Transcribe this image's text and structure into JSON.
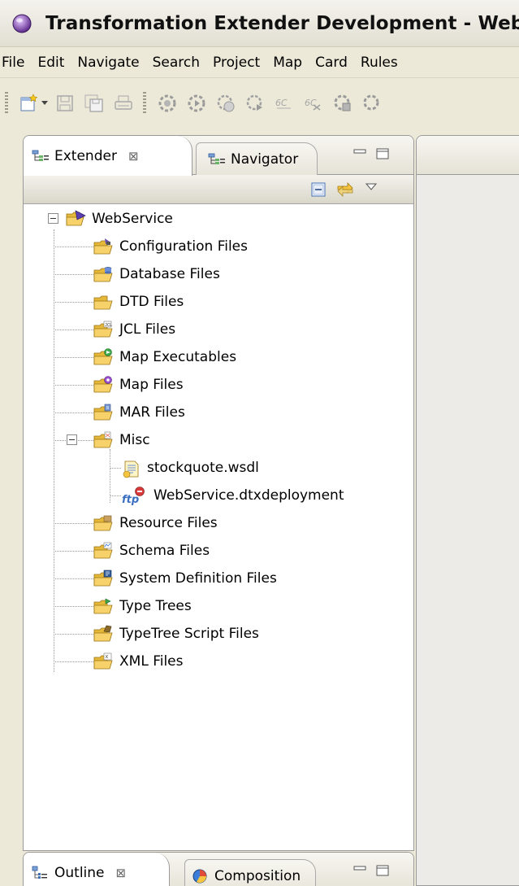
{
  "window": {
    "title": "Transformation Extender Development - Web"
  },
  "menubar": {
    "items": [
      "File",
      "Edit",
      "Navigate",
      "Search",
      "Project",
      "Map",
      "Card",
      "Rules"
    ]
  },
  "toolbar": {
    "icons": [
      "new-wizard-icon",
      "save-icon",
      "save-all-icon",
      "print-icon",
      "build-map-icon",
      "run-map-icon",
      "build-all-icon",
      "run-all-icon",
      "compare-icon",
      "compare-all-icon",
      "deploy-icon",
      "deploy-all-icon"
    ]
  },
  "explorer": {
    "tabs": [
      {
        "label": "Extender",
        "active": true
      },
      {
        "label": "Navigator",
        "active": false
      }
    ],
    "project": "WebService",
    "items": [
      {
        "label": "Configuration Files",
        "icon": "configuration-folder-icon"
      },
      {
        "label": "Database Files",
        "icon": "database-folder-icon"
      },
      {
        "label": "DTD Files",
        "icon": "folder-icon"
      },
      {
        "label": "JCL Files",
        "icon": "jcl-folder-icon"
      },
      {
        "label": "Map Executables",
        "icon": "map-executables-folder-icon"
      },
      {
        "label": "Map Files",
        "icon": "map-files-folder-icon"
      },
      {
        "label": "MAR Files",
        "icon": "mar-folder-icon"
      },
      {
        "label": "Misc",
        "icon": "misc-folder-icon"
      },
      {
        "label": "stockquote.wsdl",
        "icon": "wsdl-file-icon"
      },
      {
        "label": "WebService.dtxdeployment",
        "icon": "ftp-deployment-icon"
      },
      {
        "label": "Resource Files",
        "icon": "resource-folder-icon"
      },
      {
        "label": "Schema Files",
        "icon": "schema-folder-icon"
      },
      {
        "label": "System Definition Files",
        "icon": "system-definition-folder-icon"
      },
      {
        "label": "Type Trees",
        "icon": "type-tree-folder-icon"
      },
      {
        "label": "TypeTree Script Files",
        "icon": "typetree-script-folder-icon"
      },
      {
        "label": "XML Files",
        "icon": "xml-folder-icon"
      }
    ]
  },
  "outline": {
    "tabs": [
      {
        "label": "Outline",
        "active": true
      },
      {
        "label": "Composition",
        "active": false
      }
    ]
  },
  "colors": {
    "chrome": "#ece9d8",
    "folder": "#f5c542",
    "view_border": "#9a9a9a"
  }
}
